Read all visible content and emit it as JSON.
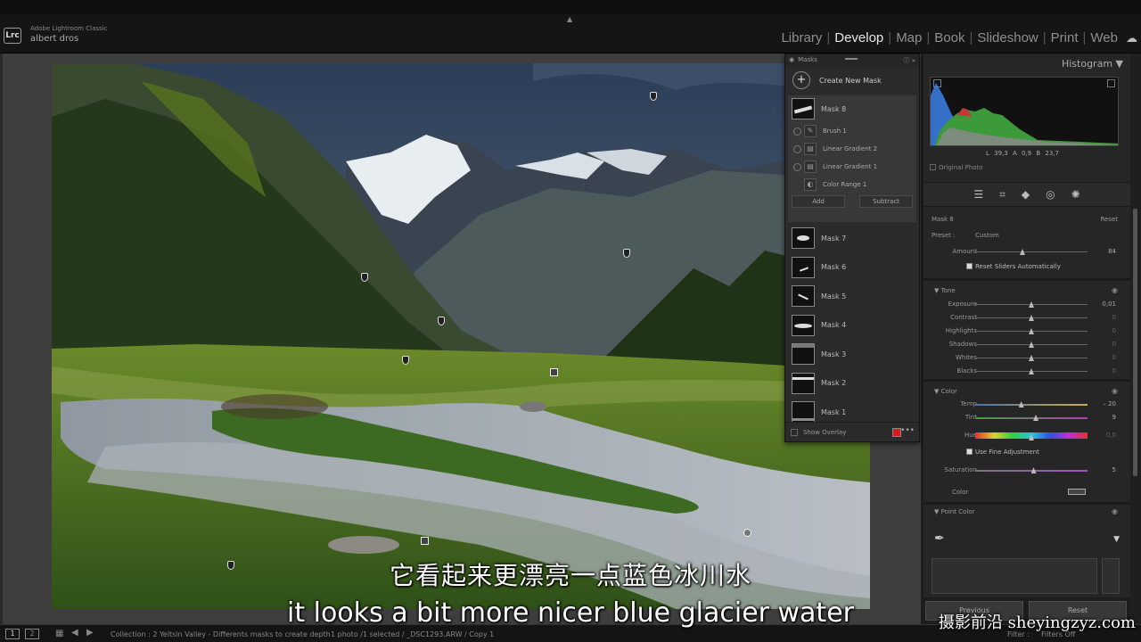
{
  "app": {
    "logo": "Lrc",
    "name": "Adobe Lightroom Classic",
    "user": "albert dros"
  },
  "modules": [
    {
      "label": "Library",
      "active": false
    },
    {
      "label": "Develop",
      "active": true
    },
    {
      "label": "Map",
      "active": false
    },
    {
      "label": "Book",
      "active": false
    },
    {
      "label": "Slideshow",
      "active": false
    },
    {
      "label": "Print",
      "active": false
    },
    {
      "label": "Web",
      "active": false
    }
  ],
  "icons": {
    "cloud": "cloud-icon",
    "eye": "eye-icon",
    "help": "help-icon",
    "expand": "double-chevron-icon"
  },
  "masks_panel": {
    "title": "Masks",
    "create_new": "Create New Mask",
    "selected_mask": "Mask 8",
    "components": [
      {
        "label": "Brush 1",
        "tool": "brush"
      },
      {
        "label": "Linear Gradient 2",
        "tool": "gradient"
      },
      {
        "label": "Linear Gradient 1",
        "tool": "gradient"
      },
      {
        "label": "Color Range 1",
        "tool": "range"
      }
    ],
    "add_label": "Add",
    "subtract_label": "Subtract",
    "other_masks": [
      "Mask 7",
      "Mask 6",
      "Mask 5",
      "Mask 4",
      "Mask 3",
      "Mask 2",
      "Mask 1"
    ],
    "show_overlay": "Show Overlay",
    "overlay_color": "#d0201e"
  },
  "histogram": {
    "title": "Histogram",
    "L_label": "L",
    "L": "39,3",
    "A_label": "A",
    "A": "0,9",
    "B_label": "B",
    "B": "23,7",
    "original_photo": "Original Photo"
  },
  "mask_settings": {
    "mask_name": "Mask 8",
    "reset": "Reset",
    "preset_label": "Preset :",
    "preset_value": "Custom",
    "amount_label": "Amount",
    "amount": "84",
    "reset_sliders": "Reset Sliders Automatically"
  },
  "tone": {
    "title": "Tone",
    "sliders": [
      {
        "label": "Exposure",
        "value": "0,01",
        "pos": 0.5
      },
      {
        "label": "Contrast",
        "value": "0",
        "pos": 0.5
      },
      {
        "label": "Highlights",
        "value": "0",
        "pos": 0.5
      },
      {
        "label": "Shadows",
        "value": "0",
        "pos": 0.5
      },
      {
        "label": "Whites",
        "value": "0",
        "pos": 0.5
      },
      {
        "label": "Blacks",
        "value": "0",
        "pos": 0.5
      }
    ]
  },
  "color": {
    "title": "Color",
    "temp_label": "Temp",
    "temp": "– 20",
    "temp_pos": 0.41,
    "tint_label": "Tint",
    "tint": "9",
    "tint_pos": 0.54,
    "hue_label": "Hue",
    "hue": "0,0",
    "hue_pos": 0.5,
    "fine_adjust": "Use Fine Adjustment",
    "saturation_label": "Saturation",
    "saturation": "5",
    "saturation_pos": 0.52,
    "color_label": "Color"
  },
  "point_color": {
    "title": "Point Color"
  },
  "buttons": {
    "previous": "Previous",
    "reset": "Reset"
  },
  "filmstrip": {
    "screen1": "1",
    "screen2": "2",
    "collection": "Collection : 2 Yeltsin Valley - Differents masks to create depth",
    "selection": "1 photo /1 selected / _DSC1293.ARW / Copy 1",
    "filter": "Filter :",
    "filters_off": "Filters Off"
  },
  "subtitles": {
    "chinese": "它看起来更漂亮一点蓝色冰川水",
    "english": "it looks a bit more nicer blue glacier water"
  },
  "watermark": "摄影前沿 sheyingzyz.com"
}
